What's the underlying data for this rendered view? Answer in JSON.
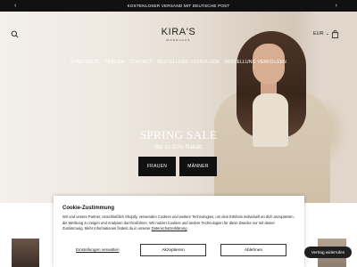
{
  "announcement": {
    "text": "KOSTENLOSER VERSAND MIT DEUTSCHE POST",
    "prev_icon": "chevron-left-icon",
    "next_icon": "chevron-right-icon"
  },
  "header": {
    "logo_main": "KIRA'S",
    "logo_sub": "MODEHAUS",
    "currency": "EUR",
    "search_icon": "search-icon",
    "cart_icon": "cart-icon"
  },
  "nav": {
    "items": [
      "STARTSEITE",
      "FRAUEN",
      "CONTACT",
      "BESTELLUNG VERFOLGEN",
      "BESTELLUNG VERFOLGEN"
    ]
  },
  "hero": {
    "title": "SPRING SALE",
    "subtitle": "Bis zu 50% Rabatt",
    "button_women": "FRAUEN",
    "button_men": "MÄNNER"
  },
  "cookie": {
    "title": "Cookie-Zustimmung",
    "body": "Wir und unsere Partner, einschließlich Shopify, verwenden Cookies und weitere Technologien, um dein Erlebnis individuell an dich anzupassen, die Werbung zu zeigen und Analysen durchzuführen. Wir nutzen Cookies und andere Technologien für diese Zwecke nur mit deiner Zustimmung. Mehr Informationen findest du in unserer",
    "link": "Datenschutzerklärung",
    "settings": "Einstellungen verwalten",
    "accept": "Akzeptieren",
    "reject": "Ablehnen"
  },
  "preferences_button": "Vertrag widerrufen",
  "colors": {
    "announcement_bg": "#111111",
    "button_bg": "#111111",
    "text_light": "#ffffff"
  }
}
